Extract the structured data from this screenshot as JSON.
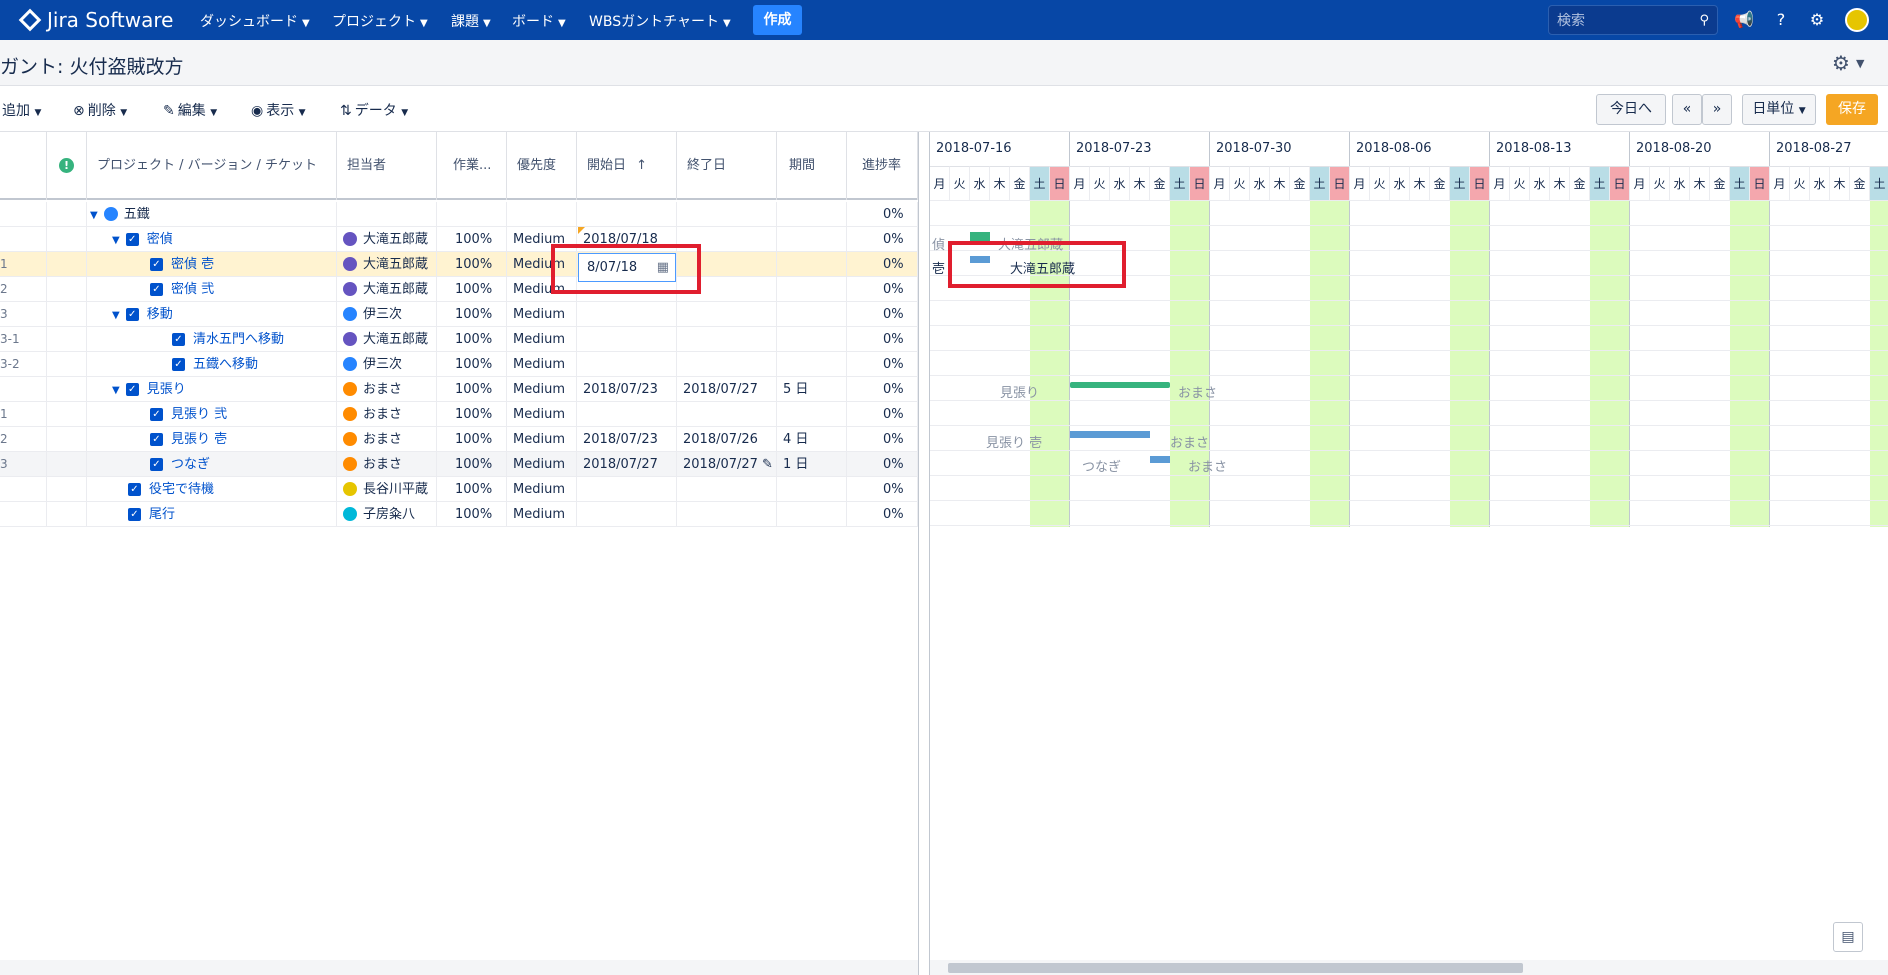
{
  "nav": {
    "logo": "Jira Software",
    "items": [
      "ダッシュボード",
      "プロジェクト",
      "課題",
      "ボード",
      "WBSガントチャート"
    ],
    "create": "作成",
    "search_placeholder": "検索"
  },
  "page": {
    "title": "ガント: 火付盗賊改方"
  },
  "toolbar": {
    "add": "追加",
    "delete": "削除",
    "edit": "編集",
    "view": "表示",
    "data": "データ",
    "today": "今日へ",
    "prev": "«",
    "next": "»",
    "scale": "日単位",
    "save": "保存"
  },
  "columns": [
    "プロジェクト / バージョン / チケット",
    "担当者",
    "作業...",
    "優先度",
    "開始日",
    "終了日",
    "期間",
    "進捗率"
  ],
  "rows": [
    {
      "id": "",
      "name": "五鐡",
      "assignee": "",
      "work": "",
      "priority": "",
      "start": "",
      "end": "",
      "duration": "",
      "progress": "0%"
    },
    {
      "id": "",
      "name": "密偵",
      "assignee": "大滝五郎蔵",
      "work": "100%",
      "priority": "Medium",
      "start": "2018/07/18",
      "end": "",
      "duration": "",
      "progress": "0%"
    },
    {
      "id": "1",
      "name": "密偵 壱",
      "assignee": "大滝五郎蔵",
      "work": "100%",
      "priority": "Medium",
      "start": "",
      "end": "",
      "duration": "",
      "progress": "0%"
    },
    {
      "id": "2",
      "name": "密偵 弐",
      "assignee": "大滝五郎蔵",
      "work": "100%",
      "priority": "Medium",
      "start": "",
      "end": "",
      "duration": "",
      "progress": "0%"
    },
    {
      "id": "3",
      "name": "移動",
      "assignee": "伊三次",
      "work": "100%",
      "priority": "Medium",
      "start": "",
      "end": "",
      "duration": "",
      "progress": "0%"
    },
    {
      "id": "3-1",
      "name": "清水五門へ移動",
      "assignee": "大滝五郎蔵",
      "work": "100%",
      "priority": "Medium",
      "start": "",
      "end": "",
      "duration": "",
      "progress": "0%"
    },
    {
      "id": "3-2",
      "name": "五鐡へ移動",
      "assignee": "伊三次",
      "work": "100%",
      "priority": "Medium",
      "start": "",
      "end": "",
      "duration": "",
      "progress": "0%"
    },
    {
      "id": "",
      "name": "見張り",
      "assignee": "おまさ",
      "work": "100%",
      "priority": "Medium",
      "start": "2018/07/23",
      "end": "2018/07/27",
      "duration": "5 日",
      "progress": "0%"
    },
    {
      "id": "1",
      "name": "見張り 弐",
      "assignee": "おまさ",
      "work": "100%",
      "priority": "Medium",
      "start": "",
      "end": "",
      "duration": "",
      "progress": "0%"
    },
    {
      "id": "2",
      "name": "見張り 壱",
      "assignee": "おまさ",
      "work": "100%",
      "priority": "Medium",
      "start": "2018/07/23",
      "end": "2018/07/26",
      "duration": "4 日",
      "progress": "0%"
    },
    {
      "id": "3",
      "name": "つなぎ",
      "assignee": "おまさ",
      "work": "100%",
      "priority": "Medium",
      "start": "2018/07/27",
      "end": "2018/07/27",
      "duration": "1 日",
      "progress": "0%"
    },
    {
      "id": "",
      "name": "役宅で待機",
      "assignee": "長谷川平蔵",
      "work": "100%",
      "priority": "Medium",
      "start": "",
      "end": "",
      "duration": "",
      "progress": "0%"
    },
    {
      "id": "",
      "name": "尾行",
      "assignee": "子房粂八",
      "work": "100%",
      "priority": "Medium",
      "start": "",
      "end": "",
      "duration": "",
      "progress": "0%"
    }
  ],
  "date_editor": {
    "value": "8/07/18"
  },
  "gantt": {
    "weeks": [
      "2018-07-16",
      "2018-07-23",
      "2018-07-30",
      "2018-08-06",
      "2018-08-13",
      "2018-08-20",
      "2018-08-27"
    ],
    "days": [
      "月",
      "火",
      "水",
      "木",
      "金",
      "土",
      "日"
    ],
    "labels": {
      "mittei_left": "偵",
      "mittei_right": "大滝五郎蔵",
      "mittei1_left": "壱",
      "mittei1_right": "大滝五郎蔵",
      "mihari_left": "見張り",
      "mihari_right": "おまさ",
      "mihari1_left": "見張り 壱",
      "mihari1_right": "おまさ",
      "tsunagi_left": "つなぎ",
      "tsunagi_right": "おまさ"
    }
  }
}
